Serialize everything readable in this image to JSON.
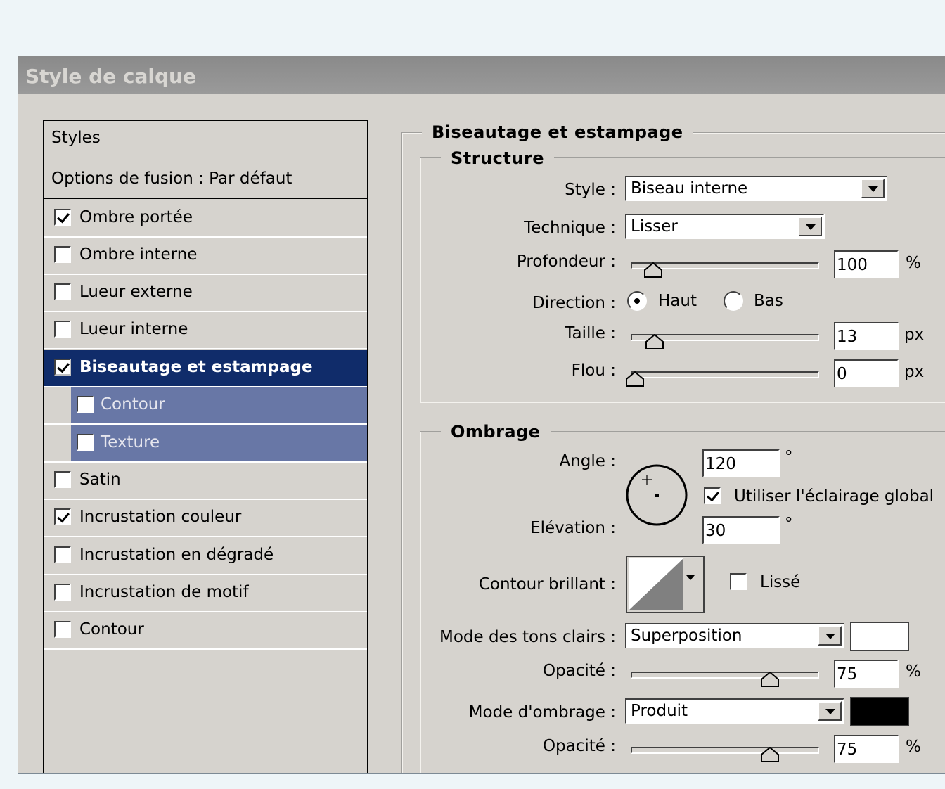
{
  "dialog": {
    "title": "Style de calque"
  },
  "styles_list": {
    "header": "Styles",
    "blending_options": "Options de fusion : Par défaut",
    "items": [
      {
        "label": "Ombre portée",
        "checked": true
      },
      {
        "label": "Ombre interne",
        "checked": false
      },
      {
        "label": "Lueur externe",
        "checked": false
      },
      {
        "label": "Lueur interne",
        "checked": false
      },
      {
        "label": "Biseautage et estampage",
        "checked": true,
        "selected": true
      },
      {
        "label": "Contour",
        "checked": false,
        "sub": true
      },
      {
        "label": "Texture",
        "checked": false,
        "sub": true
      },
      {
        "label": "Satin",
        "checked": false
      },
      {
        "label": "Incrustation couleur",
        "checked": true
      },
      {
        "label": "Incrustation en dégradé",
        "checked": false
      },
      {
        "label": "Incrustation de motif",
        "checked": false
      },
      {
        "label": "Contour",
        "checked": false
      }
    ]
  },
  "bevel": {
    "section_title": "Biseautage et estampage",
    "structure": {
      "title": "Structure",
      "style_label": "Style :",
      "style_value": "Biseau interne",
      "technique_label": "Technique :",
      "technique_value": "Lisser",
      "depth_label": "Profondeur :",
      "depth_value": "100",
      "depth_unit": "%",
      "depth_slider_fraction": 0.1,
      "direction_label": "Direction :",
      "direction_up": "Haut",
      "direction_down": "Bas",
      "direction_selected": "Haut",
      "size_label": "Taille :",
      "size_value": "13",
      "size_unit": "px",
      "size_slider_fraction": 0.11,
      "soften_label": "Flou :",
      "soften_value": "0",
      "soften_unit": "px",
      "soften_slider_fraction": 0.0
    },
    "shading": {
      "title": "Ombrage",
      "angle_label": "Angle :",
      "angle_value": "120",
      "angle_unit": "°",
      "global_light_label": "Utiliser l'éclairage global",
      "global_light_checked": true,
      "altitude_label": "Elévation :",
      "altitude_value": "30",
      "altitude_unit": "°",
      "gloss_contour_label": "Contour brillant :",
      "antialiased_label": "Lissé",
      "antialiased_checked": false,
      "highlight_mode_label": "Mode des tons clairs :",
      "highlight_mode_value": "Superposition",
      "highlight_color": "#ffffff",
      "highlight_opacity_label": "Opacité :",
      "highlight_opacity_value": "75",
      "highlight_opacity_unit": "%",
      "highlight_opacity_fraction": 0.75,
      "shadow_mode_label": "Mode d'ombrage :",
      "shadow_mode_value": "Produit",
      "shadow_color": "#000000",
      "shadow_opacity_label": "Opacité :",
      "shadow_opacity_value": "75",
      "shadow_opacity_unit": "%",
      "shadow_opacity_fraction": 0.75
    }
  },
  "colors": {
    "dialog_bg": "#d6d3ce",
    "selection": "#102c6a",
    "sub_selection": "#6877a6"
  }
}
